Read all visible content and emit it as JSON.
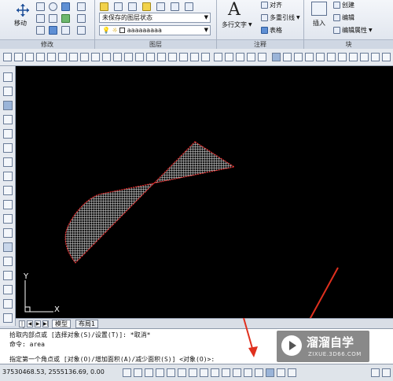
{
  "ribbon": {
    "move_label": "移动",
    "modify_panel": "修改",
    "layer_panel": "图层",
    "annotation_panel": "注释",
    "block_panel": "块",
    "layer_state": "未保存的图层状态",
    "layer_name": "aaaaaaaaa",
    "multiline_text": "多行文字",
    "align_label": "对齐",
    "multileader_label": "多重引线",
    "table_label": "表格",
    "insert_label": "插入",
    "create_label": "创建",
    "edit_label": "编辑",
    "edit_attr_label": "编辑属性"
  },
  "tabs": {
    "model": "模型",
    "layout1": "布局1"
  },
  "command": {
    "line1": "拾取内部点或 [选择对象(S)/设置(T)]: *取消*",
    "line2": "命令: area",
    "line3": "指定第一个角点或 [对象(O)/增加面积(A)/减少面积(S)] <对象(O)>:"
  },
  "status": {
    "coords": "37530468.53, 2555136.69, 0.00"
  },
  "ucs": {
    "x_label": "X",
    "y_label": "Y"
  },
  "watermark": {
    "brand": "溜溜自学",
    "url": "ZIXUE.3D66.COM"
  },
  "colors": {
    "canvas": "#000000",
    "hatch_edge": "#ff2a2a",
    "arrow": "#e0301e"
  }
}
